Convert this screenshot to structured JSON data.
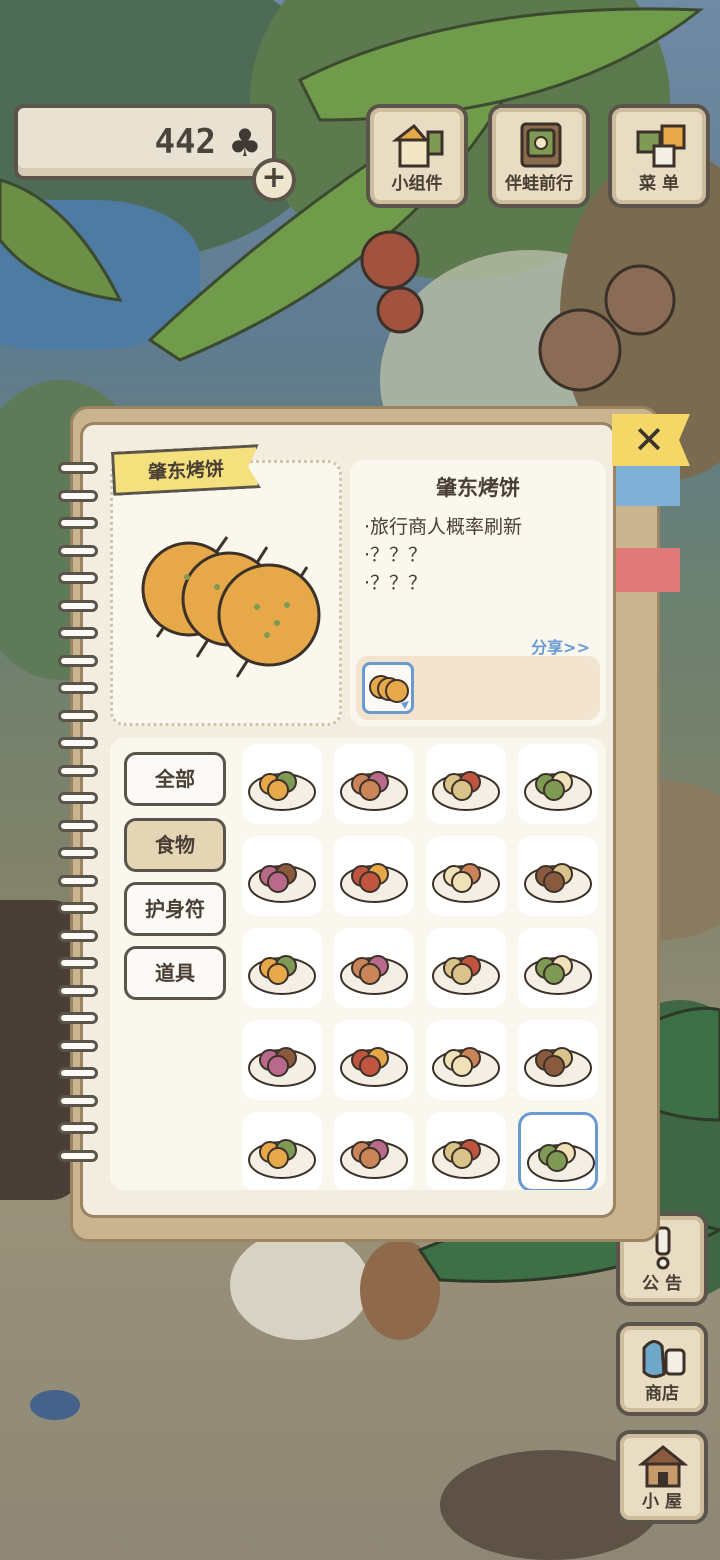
{
  "currency": {
    "value": "442",
    "icon": "clover-icon",
    "add_label": "+"
  },
  "top_buttons": [
    {
      "label": "小组件",
      "icon": "widget-icon"
    },
    {
      "label": "伴蛙前行",
      "icon": "frog-travel-icon"
    },
    {
      "label": "菜 单",
      "icon": "menu-icon"
    }
  ],
  "side_buttons": [
    {
      "label": "公 告",
      "icon": "exclamation-icon"
    },
    {
      "label": "商店",
      "icon": "shop-icon"
    },
    {
      "label": "小 屋",
      "icon": "house-icon"
    }
  ],
  "notebook": {
    "close_label": "✕",
    "selected_item": {
      "name_banner": "肇东烤饼",
      "name_title": "肇东烤饼",
      "info_lines": [
        "·旅行商人概率刷新",
        "·？？？",
        "·？？？"
      ],
      "share_label": "分享>>"
    },
    "categories": [
      {
        "label": "全部",
        "active": false
      },
      {
        "label": "食物",
        "active": true
      },
      {
        "label": "护身符",
        "active": false
      },
      {
        "label": "道具",
        "active": false
      }
    ],
    "items": [
      {
        "icon": "mixed-vegetables-bowl-icon"
      },
      {
        "icon": "tofu-plate-icon"
      },
      {
        "icon": "sliced-sausage-plate-icon"
      },
      {
        "icon": "noodle-soup-bowl-icon"
      },
      {
        "icon": "candied-hawthorn-skewers-icon"
      },
      {
        "icon": "purple-rice-cakes-icon"
      },
      {
        "icon": "soup-bowl-icon"
      },
      {
        "icon": "dumplings-plate-icon"
      },
      {
        "icon": "steamed-egg-icon"
      },
      {
        "icon": "dumpling-bowl-icon"
      },
      {
        "icon": "braised-pork-icon"
      },
      {
        "icon": "red-bean-soup-icon"
      },
      {
        "icon": "cookies-plate-icon"
      },
      {
        "icon": "mooncakes-plate-icon"
      },
      {
        "icon": "crackers-stack-icon"
      },
      {
        "icon": "fried-balls-plate-icon"
      },
      {
        "icon": "stamped-pastry-icon"
      },
      {
        "icon": "green-bean-cake-icon"
      },
      {
        "icon": "crispy-pastry-icon"
      },
      {
        "icon": "zhaodong-flatbread-icon",
        "selected": true
      }
    ]
  }
}
